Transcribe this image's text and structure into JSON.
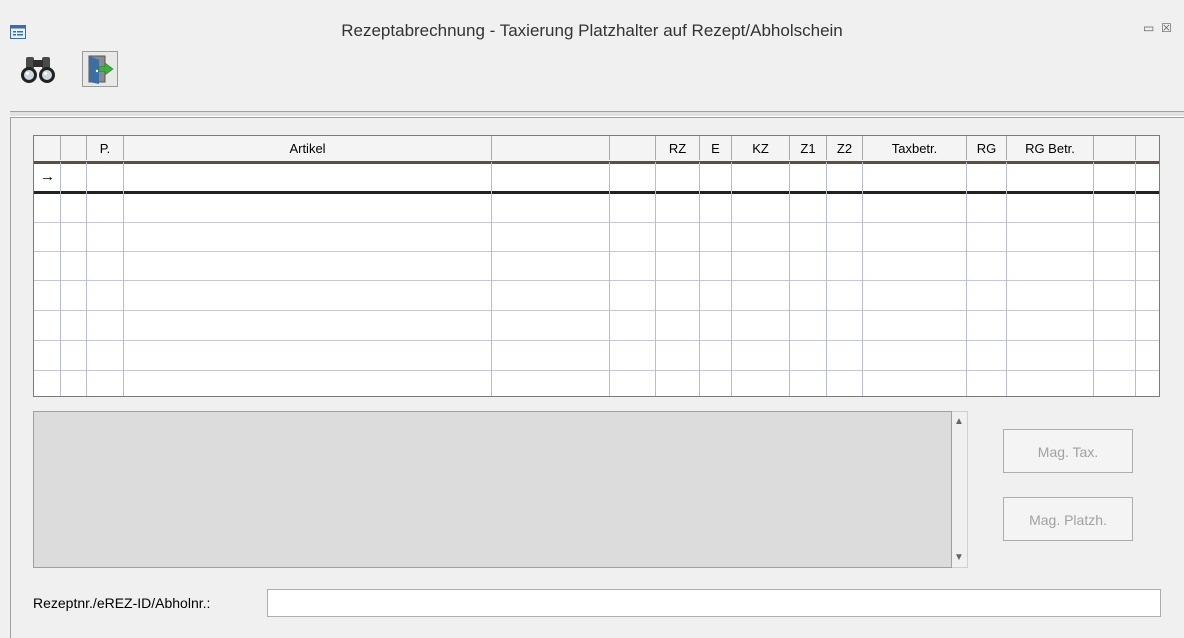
{
  "window": {
    "title": "Rezeptabrechnung - Taxierung Platzhalter auf Rezept/Abholschein",
    "minimize_glyph": "▭",
    "close_glyph": "☒"
  },
  "toolbar": {
    "icons": [
      "binoculars-icon",
      "exit-door-icon"
    ]
  },
  "grid": {
    "columns": [
      "",
      "",
      "P.",
      "Artikel",
      "",
      "",
      "RZ",
      "E",
      "KZ",
      "Z1",
      "Z2",
      "Taxbetr.",
      "RG",
      "RG Betr.",
      "",
      ""
    ],
    "current_row_marker": "→",
    "rows": []
  },
  "memo": {
    "text": ""
  },
  "scrollbar": {
    "up": "▲",
    "down": "▼"
  },
  "buttons": {
    "mag_tax": "Mag. Tax.",
    "mag_platzh": "Mag. Platzh."
  },
  "rezept_field": {
    "label": "Rezeptnr./eREZ-ID/Abholnr.:",
    "value": ""
  },
  "colors": {
    "disabled_text": "#a0a0a0",
    "memo_background": "#dcdcdc"
  }
}
